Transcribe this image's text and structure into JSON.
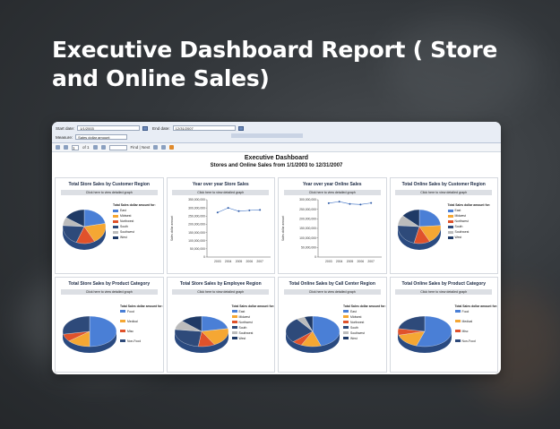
{
  "headline": "Executive Dashboard Report ( Store and Online Sales)",
  "params": {
    "start_label": "Start date:",
    "start_value": "1/1/2003",
    "end_label": "End date:",
    "end_value": "12/31/2007",
    "measure_label": "Measure:",
    "measure_value": "Sales dollar amount"
  },
  "toolbar": {
    "page_current": "1",
    "page_of": "of 1",
    "find_label": "Find | Next"
  },
  "report": {
    "title": "Executive Dashboard",
    "subtitle": "Stores and Online Sales from 1/1/2003 to 12/31/2007"
  },
  "drill_label": "Click here to view detailed graph",
  "legend_title": "Total Sales dollar amount for:",
  "colors": {
    "blue": "#4a7fd6",
    "orange": "#f5a733",
    "red": "#e0522b",
    "navy": "#2e4a7a",
    "gray": "#bcbcbc",
    "darkblue": "#1f3a66",
    "accent": "#4a7fd6"
  },
  "panels": [
    {
      "title": "Total Store Sales by Customer Region",
      "legend": [
        "East",
        "Midwest",
        "Northwest",
        "South",
        "Southwest",
        "West"
      ]
    },
    {
      "title": "Year over year Store Sales",
      "chart_data": {
        "type": "line",
        "x": [
          "2003",
          "2004",
          "2005",
          "2006",
          "2007"
        ],
        "values": [
          272000000,
          300000000,
          280000000,
          285000000,
          288000000
        ],
        "ylim": [
          0,
          350000000
        ],
        "yticks": [
          "350,000,000",
          "300,000,000",
          "250,000,000",
          "200,000,000",
          "150,000,000",
          "100,000,000",
          "50,000,000",
          "0"
        ],
        "ylabel": "Sales dollar amount"
      }
    },
    {
      "title": "Year over year Online Sales",
      "chart_data": {
        "type": "line",
        "x": [
          "2003",
          "2004",
          "2005",
          "2006",
          "2007"
        ],
        "values": [
          282000000,
          290000000,
          278000000,
          275000000,
          283000000
        ],
        "ylim": [
          0,
          300000000
        ],
        "yticks": [
          "300,000,000",
          "250,000,000",
          "200,000,000",
          "150,000,000",
          "100,000,000",
          "50,000,000",
          "0"
        ],
        "ylabel": "Sales dollar amount"
      }
    },
    {
      "title": "Total Online Sales by Customer Region",
      "legend": [
        "East",
        "Midwest",
        "Northwest",
        "South",
        "Southwest",
        "West"
      ]
    },
    {
      "title": "Total Store Sales by Product Category",
      "legend": [
        "Food",
        "Medical",
        "Misc",
        "Non-Food"
      ]
    },
    {
      "title": "Total Store Sales by Employee Region",
      "legend": [
        "East",
        "Midwest",
        "Northwest",
        "South",
        "Southwest",
        "West"
      ]
    },
    {
      "title": "Total Online Sales by Call Center Region",
      "legend": [
        "East",
        "Midwest",
        "Northwest",
        "South",
        "Southwest",
        "West"
      ]
    },
    {
      "title": "Total Online Sales by Product Category",
      "legend": [
        "Food",
        "Medical",
        "Misc",
        "Non-Food"
      ]
    }
  ]
}
